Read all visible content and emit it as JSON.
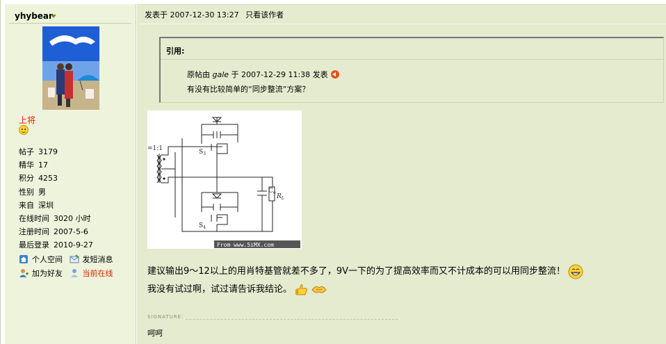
{
  "author": {
    "username": "yhybear",
    "rank": "上将",
    "stats": [
      {
        "label": "帖子",
        "value": "3179"
      },
      {
        "label": "精华",
        "value": "17"
      },
      {
        "label": "积分",
        "value": "4253"
      },
      {
        "label": "性别",
        "value": "男"
      },
      {
        "label": "来自",
        "value": "深圳"
      },
      {
        "label": "在线时间",
        "value": "3020 小时"
      },
      {
        "label": "注册时间",
        "value": "2007-5-6"
      },
      {
        "label": "最后登录",
        "value": "2010-9-27"
      }
    ],
    "actions": {
      "space": "个人空间",
      "message": "发短消息",
      "add_friend": "加为好友",
      "online_status": "当前在线"
    }
  },
  "post": {
    "posted_at": "发表于 2007-12-30 13:27",
    "only_author": "只看该作者",
    "quote": {
      "title": "引用:",
      "prefix": "原帖由",
      "author": "gale",
      "suffix": "于 2007-12-29 11:38 发表",
      "text": "有没有比较简单的“同步整流”方案？"
    },
    "figure": {
      "ratio_label": "=1:1",
      "s3": "S",
      "s3_sub": "3",
      "s4": "S",
      "s4_sub": "4",
      "co": "C",
      "co_sub": "o",
      "rl": "R",
      "rl_sub": "L",
      "watermark": "From www.5iMX.com"
    },
    "body_line1": "建议输出9～12以上的用肖特基管就差不多了，9V一下的为了提高效率而又不计成本的可以用同步整流！",
    "body_line2": "我没有试过啊，试过请告诉我结论。",
    "signature_label": "SIGNATURE:",
    "signature_text": "呵呵"
  },
  "colors": {
    "profile_bg": "#eef3dc",
    "post_bg": "#e4ebcf",
    "rank": "#e02000",
    "online": "#e02000"
  },
  "icons": [
    "dropdown-arrow-icon",
    "smile-icon",
    "home-icon",
    "message-icon",
    "add-friend-icon",
    "online-user-icon",
    "back-arrow-icon",
    "grin-emoji-icon",
    "thumbs-up-icon",
    "handshake-icon"
  ]
}
